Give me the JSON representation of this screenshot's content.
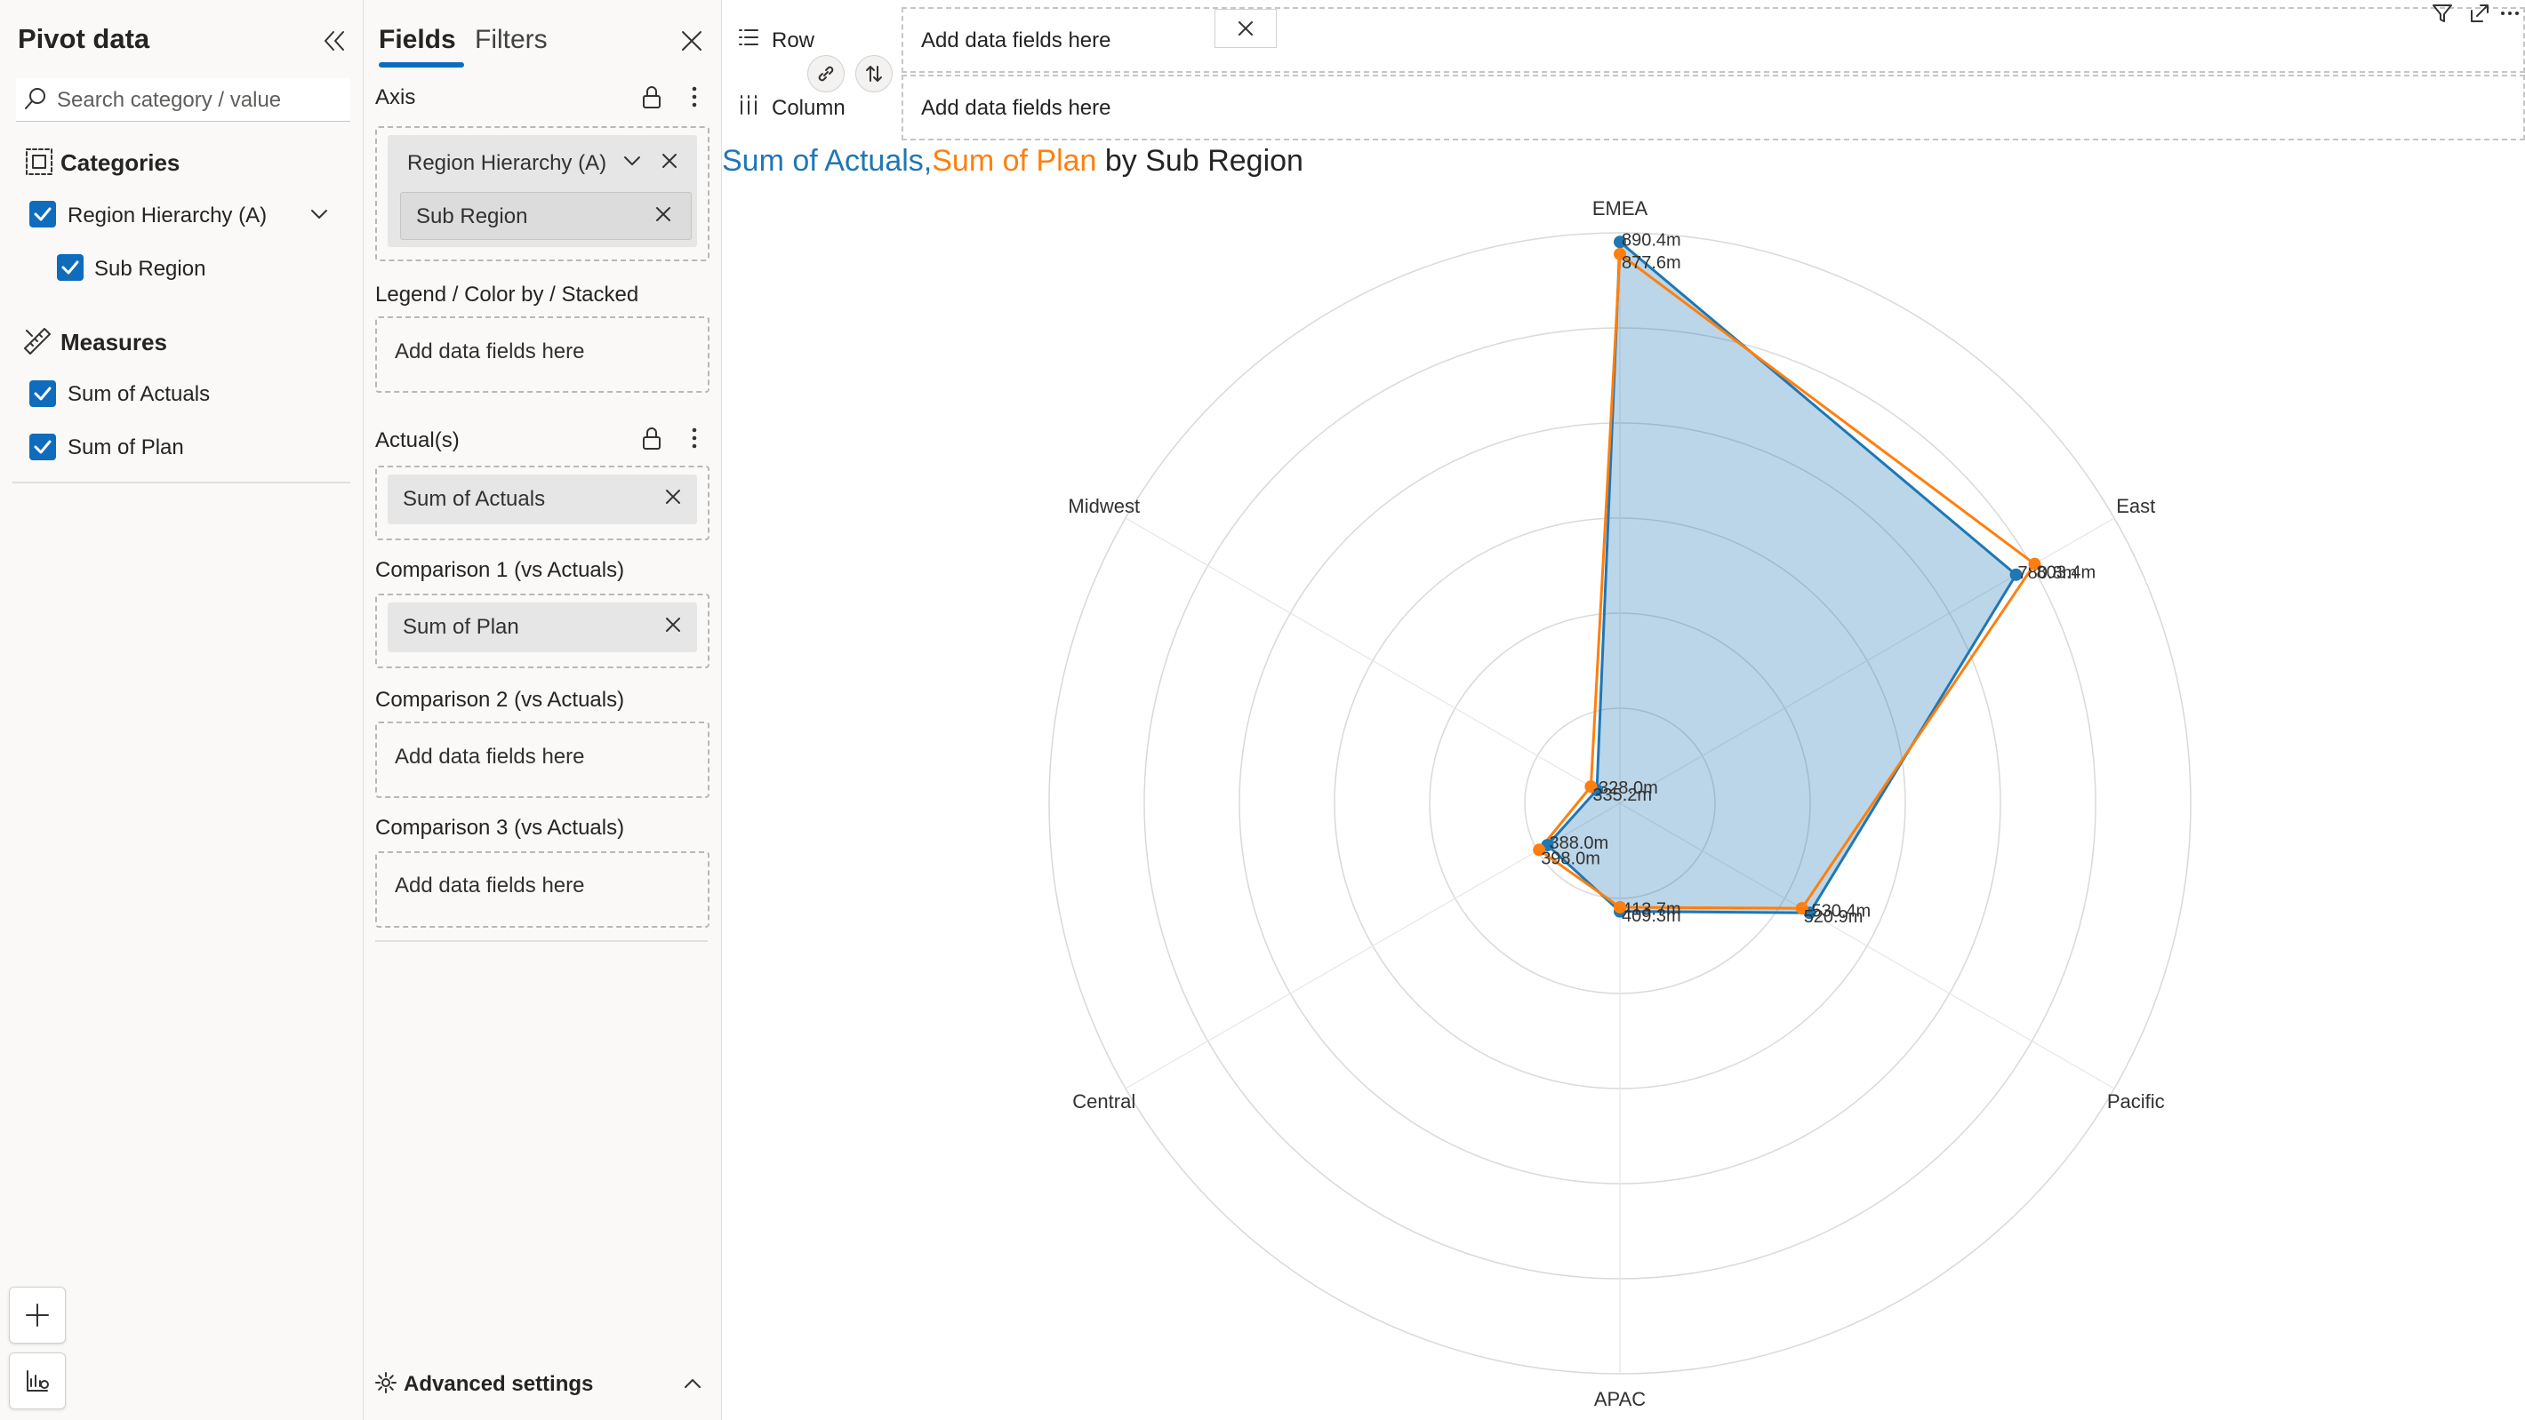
{
  "pivot_panel": {
    "title": "Pivot data",
    "search_placeholder": "Search category / value",
    "categories_header": "Categories",
    "categories": [
      {
        "label": "Region Hierarchy (A)",
        "checked": true,
        "expanded": true
      },
      {
        "label": "Sub Region",
        "checked": true
      }
    ],
    "measures_header": "Measures",
    "measures": [
      {
        "label": "Sum of Actuals",
        "checked": true
      },
      {
        "label": "Sum of Plan",
        "checked": true
      }
    ]
  },
  "fields_panel": {
    "tabs": [
      "Fields",
      "Filters"
    ],
    "active_tab": "Fields",
    "axis": {
      "label": "Axis",
      "pills": [
        "Region Hierarchy (A)",
        "Sub Region"
      ]
    },
    "legend": {
      "label": "Legend / Color by / Stacked",
      "placeholder": "Add data fields here"
    },
    "actuals": {
      "label": "Actual(s)",
      "pill": "Sum of Actuals"
    },
    "comparison1": {
      "label": "Comparison 1 (vs Actuals)",
      "pill": "Sum of Plan"
    },
    "comparison2": {
      "label": "Comparison 2 (vs Actuals)",
      "placeholder": "Add data fields here"
    },
    "comparison3": {
      "label": "Comparison 3 (vs Actuals)",
      "placeholder": "Add data fields here"
    },
    "advanced_settings": "Advanced settings"
  },
  "shelves": {
    "row": {
      "label": "Row",
      "placeholder": "Add data fields here"
    },
    "column": {
      "label": "Column",
      "placeholder": "Add data fields here"
    }
  },
  "chart_title": {
    "part1": "Sum of Actuals",
    "separator": ",",
    "part2": "Sum of Plan",
    "part3": " by Sub Region"
  },
  "colors": {
    "actuals": "#1f77b4",
    "plan": "#ff7f0e",
    "actuals_fill": "rgba(31,119,180,0.3)",
    "title_text": "#252423",
    "accent": "#0f6cbd",
    "grid": "#d9d9d9"
  },
  "chart_data": {
    "type": "radar",
    "categories": [
      "EMEA",
      "East",
      "Pacific",
      "APAC",
      "Central",
      "Midwest"
    ],
    "series": [
      {
        "name": "Sum of Actuals",
        "values": [
          890.4,
          780.8,
          530.4,
          413.7,
          388.0,
          328.0
        ],
        "labels": [
          "890.4m",
          "780.8m",
          "530.4m",
          "413.7m",
          "388.0m",
          "328.0m"
        ]
      },
      {
        "name": "Sum of Plan",
        "values": [
          877.6,
          803.4,
          520.9,
          409.3,
          398.0,
          335.2
        ],
        "labels": [
          "877.6m",
          "803.4m",
          "520.9m",
          "409.3m",
          "398.0m",
          "335.2m"
        ]
      }
    ],
    "rlim": [
      300,
      900
    ],
    "rings": 6,
    "grid": true,
    "legend": "none"
  }
}
